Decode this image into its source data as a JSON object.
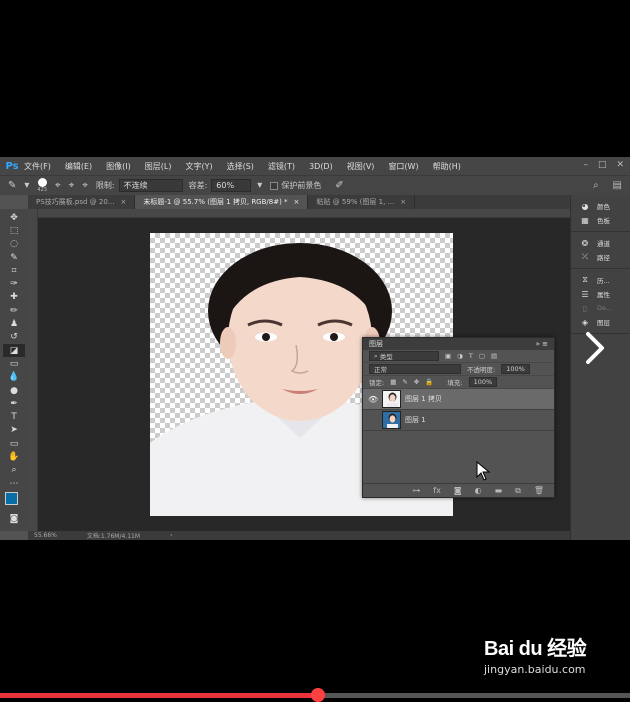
{
  "app": {
    "logo": "Ps"
  },
  "menu": [
    "文件(F)",
    "编辑(E)",
    "图像(I)",
    "图层(L)",
    "文字(Y)",
    "选择(S)",
    "滤镜(T)",
    "3D(D)",
    "视图(V)",
    "窗口(W)",
    "帮助(H)"
  ],
  "options_bar": {
    "brush_size": "423",
    "limits_label": "限制:",
    "limits_value": "不连续",
    "tolerance_label": "容差:",
    "tolerance_value": "60%",
    "protect_fg_label": "保护前景色"
  },
  "tabs": [
    {
      "label": "PS技巧展板.psd @ 20...",
      "close": "×"
    },
    {
      "label": "未标题-1 @ 55.7% (图层 1 拷贝, RGB/8#) *",
      "close": "×"
    },
    {
      "label": "粘贴 @ 59% (图层 1, ...",
      "close": "×"
    }
  ],
  "status_bar": {
    "zoom": "55.66%",
    "doc_info": "文档:1.76M/4.11M"
  },
  "right_dock": {
    "group1": [
      {
        "icon": "palette-icon",
        "label": "颜色"
      },
      {
        "icon": "swatches-icon",
        "label": "色板"
      }
    ],
    "group2": [
      {
        "icon": "channels-icon",
        "label": "通道"
      },
      {
        "icon": "paths-icon",
        "label": "路径"
      }
    ],
    "group3": [
      {
        "icon": "history-icon",
        "label": "历..."
      },
      {
        "icon": "properties-icon",
        "label": "属性"
      },
      {
        "icon": "device-icon",
        "label": "De..."
      },
      {
        "icon": "layers-icon",
        "label": "图层"
      }
    ]
  },
  "layers_panel": {
    "title": "图层",
    "filter_label": "类型",
    "blend_mode": "正常",
    "opacity_label": "不透明度:",
    "opacity_value": "100%",
    "lock_label": "锁定:",
    "fill_label": "填充:",
    "fill_value": "100%",
    "layers": [
      {
        "name": "图层 1 拷贝",
        "visible": true,
        "selected": true
      },
      {
        "name": "图层 1",
        "visible": false,
        "selected": false
      }
    ]
  },
  "watermark": {
    "logo": "Bai du 经验",
    "url": "jingyan.baidu.com"
  },
  "video": {
    "progress_fraction": 0.505
  },
  "colors": {
    "foreground": "#0a6ea6",
    "background": "#000000",
    "progress": "#e8333a",
    "accent_blue": "#31a8ff"
  }
}
